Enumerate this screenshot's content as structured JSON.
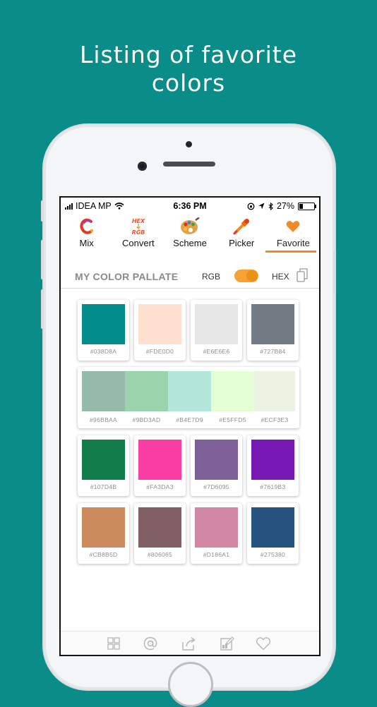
{
  "headline": {
    "line1": "Listing of favorite",
    "line2": "colors"
  },
  "status_bar": {
    "carrier": "IDEA MP",
    "time": "6:36 PM",
    "battery": "27%"
  },
  "tabs": [
    {
      "label": "Mix",
      "icon": "mix-c-icon"
    },
    {
      "label": "Convert",
      "icon": "hex-rgb-icon"
    },
    {
      "label": "Scheme",
      "icon": "palette-icon"
    },
    {
      "label": "Picker",
      "icon": "color-dropper-icon"
    },
    {
      "label": "Favorite",
      "icon": "heart-icon",
      "active": true
    }
  ],
  "section": {
    "title": "MY COLOR PALLATE",
    "rgb_label": "RGB",
    "hex_label": "HEX",
    "toggle_on": true
  },
  "colors": {
    "row1": [
      {
        "code": "#038D8A",
        "hex": "#038D8A"
      },
      {
        "code": "#FDE0D0",
        "hex": "#FDE0D0"
      },
      {
        "code": "#E6E6E6",
        "hex": "#E6E6E6"
      },
      {
        "code": "#727B84",
        "hex": "#727B84"
      }
    ],
    "palette": [
      {
        "code": "#96BBAA",
        "hex": "#96BBAA"
      },
      {
        "code": "#9BD3AD",
        "hex": "#9BD3AD"
      },
      {
        "code": "#B4E7D9",
        "hex": "#B4E7D9"
      },
      {
        "code": "#E5FFD5",
        "hex": "#E5FFD5"
      },
      {
        "code": "#ECF3E3",
        "hex": "#ECF3E3"
      }
    ],
    "row3": [
      {
        "code": "#107D4B",
        "hex": "#107D4B"
      },
      {
        "code": "#FA3DA3",
        "hex": "#FA3DA3"
      },
      {
        "code": "#7D6095",
        "hex": "#7D6095"
      },
      {
        "code": "#7619B3",
        "hex": "#7619B3"
      }
    ],
    "row4": [
      {
        "code": "#CB8B5D",
        "hex": "#CB8B5D"
      },
      {
        "code": "#806065",
        "hex": "#806065"
      },
      {
        "code": "#D186A1",
        "hex": "#D186A1"
      },
      {
        "code": "#275380",
        "hex": "#275380"
      }
    ]
  },
  "bottom_bar": [
    "grid-icon",
    "at-sign-icon",
    "share-icon",
    "edit-image-icon",
    "heart-outline-icon"
  ],
  "accent": "#F08A24",
  "background": "#0A8C88"
}
